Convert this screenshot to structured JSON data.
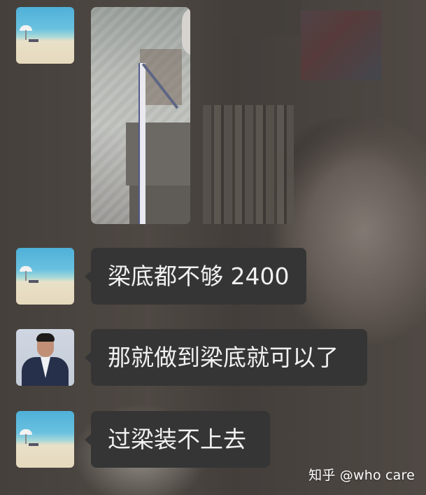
{
  "messages": [
    {
      "sender": "beach-avatar",
      "type": "image"
    },
    {
      "sender": "beach-avatar",
      "type": "text",
      "text": "梁底都不够 2400"
    },
    {
      "sender": "man-avatar",
      "type": "text",
      "text": "那就做到梁底就可以了"
    },
    {
      "sender": "beach-avatar",
      "type": "text",
      "text": "过梁装不上去"
    }
  ],
  "watermark": "知乎 @who care",
  "colors": {
    "bubble_bg": "#353535",
    "bubble_text": "#f1f1f1",
    "watermark_text": "#ffffff"
  }
}
